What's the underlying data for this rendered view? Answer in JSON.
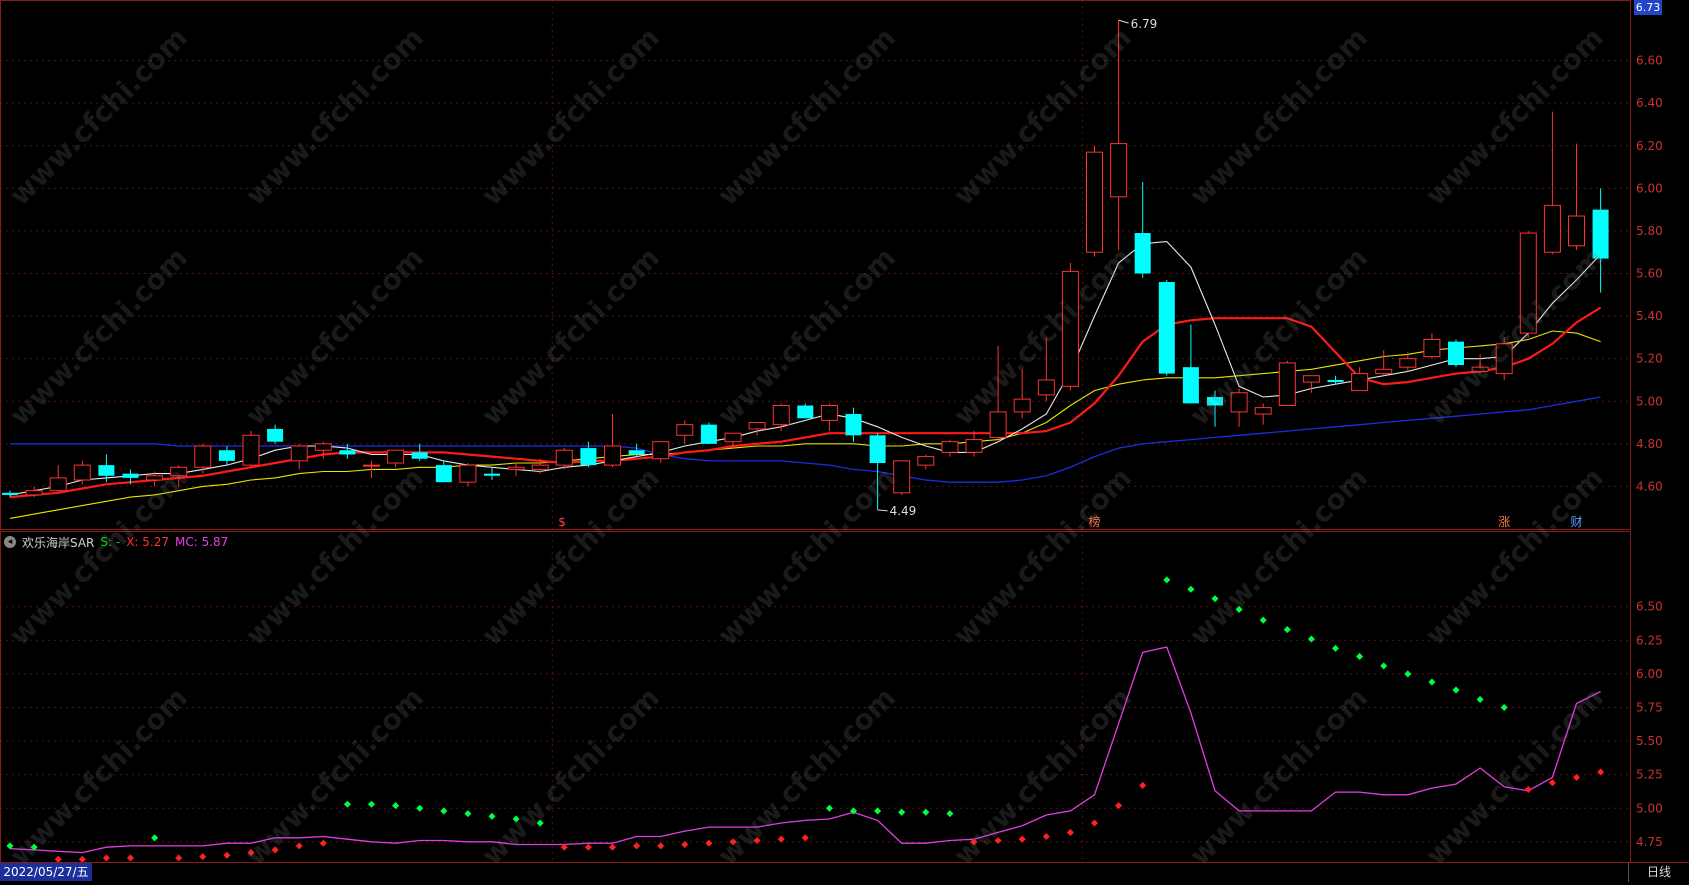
{
  "price_tag": "6.73",
  "indicator": {
    "name": "欢乐海岸SAR",
    "s_text": "S: -",
    "x_text": "X: 5.27",
    "mc_text": "MC: 5.87"
  },
  "date_label": "2022/05/27/五",
  "period_label": "日线",
  "watermark": "www.cfchi.com",
  "colors": {
    "up": "#ff3232",
    "down": "#00ffff",
    "ma5": "#e8e8e8",
    "ma10": "#ff1a1a",
    "ma20": "#e6e600",
    "ma60": "#1c2ee0",
    "mc": "#e040e0",
    "sar_up": "#00ff40",
    "sar_down": "#ff2020"
  },
  "chart_data": [
    {
      "type": "candlestick",
      "ylim": [
        4.4,
        6.8
      ],
      "yticks": [
        "6.60",
        "6.40",
        "6.20",
        "6.00",
        "5.80",
        "5.60",
        "5.40",
        "5.20",
        "5.00",
        "4.80",
        "4.60"
      ],
      "ohlc": [
        [
          4.57,
          4.58,
          4.55,
          4.56
        ],
        [
          4.56,
          4.6,
          4.55,
          4.58
        ],
        [
          4.58,
          4.7,
          4.57,
          4.64
        ],
        [
          4.63,
          4.72,
          4.61,
          4.7
        ],
        [
          4.7,
          4.75,
          4.62,
          4.65
        ],
        [
          4.66,
          4.68,
          4.61,
          4.64
        ],
        [
          4.63,
          4.67,
          4.6,
          4.65
        ],
        [
          4.65,
          4.7,
          4.6,
          4.69
        ],
        [
          4.69,
          4.8,
          4.66,
          4.79
        ],
        [
          4.77,
          4.79,
          4.7,
          4.72
        ],
        [
          4.7,
          4.86,
          4.69,
          4.84
        ],
        [
          4.87,
          4.89,
          4.8,
          4.81
        ],
        [
          4.72,
          4.8,
          4.68,
          4.79
        ],
        [
          4.77,
          4.81,
          4.73,
          4.8
        ],
        [
          4.77,
          4.8,
          4.73,
          4.75
        ],
        [
          4.7,
          4.72,
          4.64,
          4.7
        ],
        [
          4.71,
          4.77,
          4.69,
          4.77
        ],
        [
          4.76,
          4.8,
          4.72,
          4.73
        ],
        [
          4.7,
          4.72,
          4.62,
          4.62
        ],
        [
          4.62,
          4.71,
          4.6,
          4.7
        ],
        [
          4.66,
          4.69,
          4.63,
          4.65
        ],
        [
          4.68,
          4.71,
          4.65,
          4.69
        ],
        [
          4.68,
          4.73,
          4.66,
          4.7
        ],
        [
          4.7,
          4.78,
          4.68,
          4.77
        ],
        [
          4.78,
          4.81,
          4.69,
          4.7
        ],
        [
          4.7,
          4.94,
          4.69,
          4.79
        ],
        [
          4.77,
          4.8,
          4.74,
          4.75
        ],
        [
          4.73,
          4.81,
          4.71,
          4.81
        ],
        [
          4.84,
          4.91,
          4.8,
          4.89
        ],
        [
          4.89,
          4.9,
          4.8,
          4.8
        ],
        [
          4.81,
          4.85,
          4.78,
          4.85
        ],
        [
          4.87,
          4.9,
          4.84,
          4.9
        ],
        [
          4.89,
          4.99,
          4.86,
          4.98
        ],
        [
          4.98,
          4.99,
          4.92,
          4.92
        ],
        [
          4.91,
          4.99,
          4.86,
          4.98
        ],
        [
          4.94,
          4.97,
          4.81,
          4.84
        ],
        [
          4.84,
          4.85,
          4.49,
          4.71
        ],
        [
          4.57,
          4.72,
          4.56,
          4.72
        ],
        [
          4.7,
          4.75,
          4.68,
          4.74
        ],
        [
          4.76,
          4.82,
          4.74,
          4.81
        ],
        [
          4.76,
          4.86,
          4.74,
          4.82
        ],
        [
          4.83,
          5.26,
          4.82,
          4.95
        ],
        [
          4.95,
          5.15,
          4.92,
          5.01
        ],
        [
          5.03,
          5.3,
          5.0,
          5.1
        ],
        [
          5.07,
          5.65,
          5.05,
          5.61
        ],
        [
          5.7,
          6.2,
          5.68,
          6.17
        ],
        [
          5.96,
          6.79,
          5.71,
          6.21
        ],
        [
          5.79,
          6.03,
          5.58,
          5.6
        ],
        [
          5.56,
          5.57,
          5.12,
          5.13
        ],
        [
          5.16,
          5.36,
          4.99,
          4.99
        ],
        [
          5.02,
          5.05,
          4.88,
          4.98
        ],
        [
          4.95,
          5.06,
          4.88,
          5.04
        ],
        [
          4.94,
          4.99,
          4.89,
          4.97
        ],
        [
          4.98,
          5.19,
          4.98,
          5.18
        ],
        [
          5.09,
          5.12,
          5.04,
          5.12
        ],
        [
          5.1,
          5.12,
          5.08,
          5.09
        ],
        [
          5.05,
          5.16,
          5.05,
          5.13
        ],
        [
          5.13,
          5.24,
          5.12,
          5.15
        ],
        [
          5.16,
          5.23,
          5.14,
          5.2
        ],
        [
          5.21,
          5.32,
          5.2,
          5.29
        ],
        [
          5.28,
          5.29,
          5.16,
          5.17
        ],
        [
          5.14,
          5.22,
          5.13,
          5.16
        ],
        [
          5.13,
          5.3,
          5.1,
          5.27
        ],
        [
          5.32,
          5.8,
          5.3,
          5.79
        ],
        [
          5.7,
          6.36,
          5.69,
          5.92
        ],
        [
          5.73,
          6.21,
          5.71,
          5.87
        ],
        [
          5.9,
          6.0,
          5.51,
          5.67
        ]
      ],
      "ma5": [
        4.56,
        4.58,
        4.6,
        4.63,
        4.64,
        4.65,
        4.66,
        4.66,
        4.68,
        4.7,
        4.73,
        4.77,
        4.79,
        4.79,
        4.78,
        4.75,
        4.75,
        4.75,
        4.72,
        4.7,
        4.69,
        4.68,
        4.67,
        4.69,
        4.7,
        4.72,
        4.74,
        4.76,
        4.79,
        4.81,
        4.83,
        4.86,
        4.88,
        4.91,
        4.94,
        4.92,
        4.88,
        4.83,
        4.79,
        4.76,
        4.76,
        4.81,
        4.87,
        4.94,
        5.14,
        5.4,
        5.65,
        5.74,
        5.75,
        5.63,
        5.36,
        5.07,
        5.02,
        5.03,
        5.06,
        5.08,
        5.1,
        5.12,
        5.14,
        5.17,
        5.2,
        5.2,
        5.21,
        5.32,
        5.46,
        5.57,
        5.69
      ],
      "ma10": [
        4.55,
        4.56,
        4.57,
        4.59,
        4.61,
        4.62,
        4.63,
        4.64,
        4.65,
        4.67,
        4.69,
        4.71,
        4.73,
        4.75,
        4.76,
        4.76,
        4.76,
        4.76,
        4.76,
        4.75,
        4.74,
        4.73,
        4.72,
        4.71,
        4.72,
        4.72,
        4.73,
        4.74,
        4.76,
        4.77,
        4.79,
        4.8,
        4.81,
        4.83,
        4.85,
        4.85,
        4.85,
        4.85,
        4.85,
        4.85,
        4.85,
        4.85,
        4.85,
        4.86,
        4.9,
        4.99,
        5.12,
        5.28,
        5.36,
        5.38,
        5.39,
        5.39,
        5.39,
        5.39,
        5.35,
        5.23,
        5.11,
        5.08,
        5.09,
        5.11,
        5.13,
        5.14,
        5.16,
        5.2,
        5.27,
        5.37,
        5.44
      ],
      "ma20": [
        4.45,
        4.47,
        4.49,
        4.51,
        4.53,
        4.55,
        4.56,
        4.58,
        4.6,
        4.61,
        4.63,
        4.64,
        4.66,
        4.67,
        4.67,
        4.68,
        4.68,
        4.69,
        4.69,
        4.7,
        4.7,
        4.71,
        4.71,
        4.72,
        4.73,
        4.74,
        4.75,
        4.75,
        4.76,
        4.77,
        4.78,
        4.79,
        4.79,
        4.8,
        4.8,
        4.8,
        4.79,
        4.79,
        4.8,
        4.8,
        4.81,
        4.82,
        4.85,
        4.9,
        4.98,
        5.05,
        5.08,
        5.1,
        5.11,
        5.11,
        5.11,
        5.12,
        5.13,
        5.14,
        5.15,
        5.17,
        5.19,
        5.21,
        5.22,
        5.24,
        5.25,
        5.26,
        5.27,
        5.29,
        5.33,
        5.32,
        5.28
      ],
      "ma60": [
        4.8,
        4.8,
        4.8,
        4.8,
        4.8,
        4.8,
        4.8,
        4.79,
        4.79,
        4.79,
        4.79,
        4.79,
        4.79,
        4.79,
        4.79,
        4.79,
        4.79,
        4.79,
        4.79,
        4.79,
        4.79,
        4.79,
        4.79,
        4.79,
        4.79,
        4.79,
        4.78,
        4.75,
        4.73,
        4.72,
        4.72,
        4.72,
        4.72,
        4.71,
        4.7,
        4.68,
        4.67,
        4.65,
        4.63,
        4.62,
        4.62,
        4.62,
        4.63,
        4.65,
        4.69,
        4.74,
        4.78,
        4.8,
        4.81,
        4.82,
        4.83,
        4.84,
        4.85,
        4.86,
        4.87,
        4.88,
        4.89,
        4.9,
        4.91,
        4.92,
        4.93,
        4.94,
        4.95,
        4.96,
        4.98,
        5.0,
        5.02
      ],
      "annotations": [
        "6.79",
        "4.49"
      ],
      "markers": [
        {
          "index": 23,
          "text": "$"
        },
        {
          "index": 45,
          "text": "榜"
        },
        {
          "index": 62,
          "text": "涨"
        },
        {
          "index": 65,
          "text": "财"
        }
      ]
    },
    {
      "type": "scatter",
      "title": "欢乐海岸SAR",
      "ylim": [
        4.6,
        6.9
      ],
      "yticks": [
        "6.50",
        "6.25",
        "6.00",
        "5.75",
        "5.50",
        "5.25",
        "5.00",
        "4.75"
      ],
      "mc": [
        4.7,
        4.69,
        4.68,
        4.67,
        4.71,
        4.72,
        4.72,
        4.72,
        4.72,
        4.74,
        4.74,
        4.78,
        4.78,
        4.79,
        4.77,
        4.75,
        4.74,
        4.76,
        4.76,
        4.75,
        4.75,
        4.73,
        4.73,
        4.73,
        4.74,
        4.74,
        4.79,
        4.79,
        4.83,
        4.86,
        4.86,
        4.86,
        4.89,
        4.91,
        4.92,
        4.97,
        4.91,
        4.74,
        4.74,
        4.76,
        4.77,
        4.82,
        4.87,
        4.95,
        4.98,
        5.1,
        5.63,
        6.16,
        6.2,
        5.71,
        5.13,
        4.98,
        4.98,
        4.98,
        4.98,
        5.12,
        5.12,
        5.1,
        5.1,
        5.15,
        5.18,
        5.3,
        5.16,
        5.13,
        5.23,
        5.78,
        5.87
      ],
      "sar": [
        {
          "v": 4.72,
          "up": false
        },
        {
          "v": 4.71,
          "up": false
        },
        {
          "v": 4.62,
          "up": true
        },
        {
          "v": 4.62,
          "up": true
        },
        {
          "v": 4.63,
          "up": true
        },
        {
          "v": 4.63,
          "up": true
        },
        {
          "v": 4.78,
          "up": false
        },
        {
          "v": 4.63,
          "up": true
        },
        {
          "v": 4.64,
          "up": true
        },
        {
          "v": 4.65,
          "up": true
        },
        {
          "v": 4.67,
          "up": true
        },
        {
          "v": 4.69,
          "up": true
        },
        {
          "v": 4.72,
          "up": true
        },
        {
          "v": 4.74,
          "up": true
        },
        {
          "v": 5.03,
          "up": false
        },
        {
          "v": 5.03,
          "up": false
        },
        {
          "v": 5.02,
          "up": false
        },
        {
          "v": 5.0,
          "up": false
        },
        {
          "v": 4.98,
          "up": false
        },
        {
          "v": 4.96,
          "up": false
        },
        {
          "v": 4.94,
          "up": false
        },
        {
          "v": 4.92,
          "up": false
        },
        {
          "v": 4.89,
          "up": false
        },
        {
          "v": 4.71,
          "up": true
        },
        {
          "v": 4.71,
          "up": true
        },
        {
          "v": 4.71,
          "up": true
        },
        {
          "v": 4.72,
          "up": true
        },
        {
          "v": 4.72,
          "up": true
        },
        {
          "v": 4.73,
          "up": true
        },
        {
          "v": 4.74,
          "up": true
        },
        {
          "v": 4.75,
          "up": true
        },
        {
          "v": 4.76,
          "up": true
        },
        {
          "v": 4.77,
          "up": true
        },
        {
          "v": 4.78,
          "up": true
        },
        {
          "v": 5.0,
          "up": false
        },
        {
          "v": 4.98,
          "up": false
        },
        {
          "v": 4.98,
          "up": false
        },
        {
          "v": 4.97,
          "up": false
        },
        {
          "v": 4.97,
          "up": false
        },
        {
          "v": 4.96,
          "up": false
        },
        {
          "v": 4.75,
          "up": true
        },
        {
          "v": 4.76,
          "up": true
        },
        {
          "v": 4.77,
          "up": true
        },
        {
          "v": 4.79,
          "up": true
        },
        {
          "v": 4.82,
          "up": true
        },
        {
          "v": 4.89,
          "up": true
        },
        {
          "v": 5.02,
          "up": true
        },
        {
          "v": 5.17,
          "up": true
        },
        {
          "v": 6.7,
          "up": false
        },
        {
          "v": 6.63,
          "up": false
        },
        {
          "v": 6.56,
          "up": false
        },
        {
          "v": 6.48,
          "up": false
        },
        {
          "v": 6.4,
          "up": false
        },
        {
          "v": 6.33,
          "up": false
        },
        {
          "v": 6.26,
          "up": false
        },
        {
          "v": 6.19,
          "up": false
        },
        {
          "v": 6.13,
          "up": false
        },
        {
          "v": 6.06,
          "up": false
        },
        {
          "v": 6.0,
          "up": false
        },
        {
          "v": 5.94,
          "up": false
        },
        {
          "v": 5.88,
          "up": false
        },
        {
          "v": 5.81,
          "up": false
        },
        {
          "v": 5.75,
          "up": false
        },
        {
          "v": 5.14,
          "up": true
        },
        {
          "v": 5.19,
          "up": true
        },
        {
          "v": 5.23,
          "up": true
        },
        {
          "v": 5.27,
          "up": true
        }
      ]
    }
  ]
}
